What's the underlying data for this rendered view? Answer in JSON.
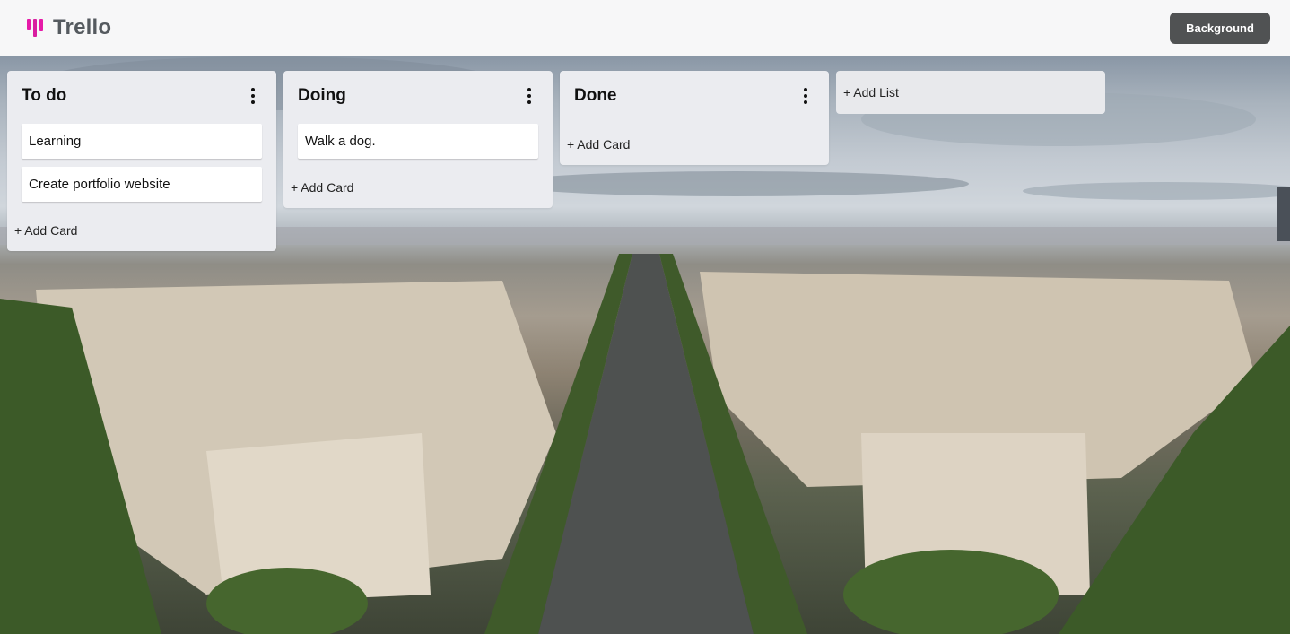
{
  "app": {
    "title": "Trello",
    "logo_colors": [
      "#e61aa8",
      "#d91ea0",
      "#e61aa8"
    ]
  },
  "header": {
    "background_button_label": "Background"
  },
  "board": {
    "lists": [
      {
        "title": "To do",
        "cards": [
          "Learning",
          "Create portfolio website"
        ],
        "add_card_label": "+ Add Card"
      },
      {
        "title": "Doing",
        "cards": [
          "Walk a dog."
        ],
        "add_card_label": "+ Add Card"
      },
      {
        "title": "Done",
        "cards": [],
        "add_card_label": "+ Add Card"
      }
    ],
    "add_list_label": "+ Add List"
  },
  "icons": {
    "list_menu": "more-vertical-icon",
    "logo": "trello-logo-icon"
  },
  "colors": {
    "header_bg": "#f7f7f8",
    "button_bg": "#505253",
    "list_bg": "#ebecf0",
    "card_bg": "#ffffff",
    "logo_accent": "#e61aa8"
  }
}
